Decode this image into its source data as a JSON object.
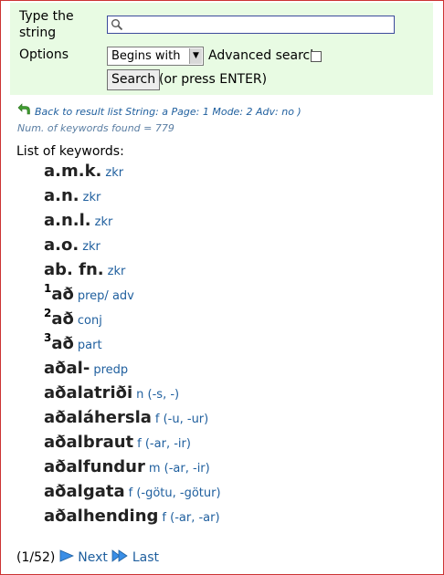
{
  "form": {
    "string_label": "Type the string",
    "string_value": "",
    "options_label": "Options",
    "options_selected": "Begins with",
    "advanced_label": "Advanced search",
    "advanced_checked": false,
    "search_button": "Search",
    "press_enter": "(or press ENTER)"
  },
  "back_link": "Back to result list String: a Page: 1 Mode: 2 Adv: no )",
  "num_found": "Num. of keywords found = 779",
  "list_title": "List of keywords:",
  "keywords": [
    {
      "sup": "",
      "word": "a.m.k.",
      "gram": "zkr"
    },
    {
      "sup": "",
      "word": "a.n.",
      "gram": "zkr"
    },
    {
      "sup": "",
      "word": "a.n.l.",
      "gram": "zkr"
    },
    {
      "sup": "",
      "word": "a.o.",
      "gram": "zkr"
    },
    {
      "sup": "",
      "word": "ab. fn.",
      "gram": "zkr"
    },
    {
      "sup": "1",
      "word": "að",
      "gram": "prep/ adv"
    },
    {
      "sup": "2",
      "word": "að",
      "gram": "conj"
    },
    {
      "sup": "3",
      "word": "að",
      "gram": "part"
    },
    {
      "sup": "",
      "word": "aðal-",
      "gram": "predp"
    },
    {
      "sup": "",
      "word": "aðalatriði",
      "gram": "n (-s, -)"
    },
    {
      "sup": "",
      "word": "aðaláhersla",
      "gram": "f (-u, -ur)"
    },
    {
      "sup": "",
      "word": "aðalbraut",
      "gram": "f (-ar, -ir)"
    },
    {
      "sup": "",
      "word": "aðalfundur",
      "gram": "m (-ar, -ir)"
    },
    {
      "sup": "",
      "word": "aðalgata",
      "gram": "f (-götu, -götur)"
    },
    {
      "sup": "",
      "word": "aðalhending",
      "gram": "f (-ar, -ar)"
    }
  ],
  "pager": {
    "position": "(1/52)",
    "next": "Next",
    "last": "Last"
  },
  "colors": {
    "panel_bg": "#e8fbe3",
    "link": "#1f5f9e",
    "border": "#cc3333"
  }
}
